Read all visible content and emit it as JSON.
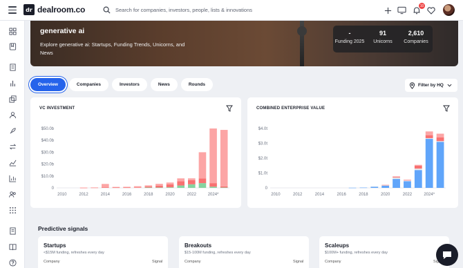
{
  "app": {
    "logo_text": "dealroom.co",
    "logo_mark": "dr"
  },
  "search": {
    "placeholder": "Search for companies, investors, people, lists & innovations"
  },
  "notifications": {
    "count": "10"
  },
  "hero": {
    "title": "generative ai",
    "description": "Explore generative ai: Startups, Funding Trends, Unicorns, and News",
    "stats": [
      {
        "value": "-",
        "label": "Funding 2025"
      },
      {
        "value": "91",
        "label": "Unicorns"
      },
      {
        "value": "2,610",
        "label": "Companies"
      }
    ]
  },
  "tabs": [
    "Overview",
    "Companies",
    "Investors",
    "News",
    "Rounds"
  ],
  "active_tab": "Overview",
  "filter_hq": "Filter by HQ",
  "vc_card": {
    "title": "VC INVESTMENT"
  },
  "ev_card": {
    "title": "COMBINED ENTERPRISE VALUE"
  },
  "chart_data": [
    {
      "type": "bar",
      "title": "VC INVESTMENT",
      "stacked": true,
      "x_ticks": [
        "2010",
        "2012",
        "2014",
        "2016",
        "2018",
        "2020",
        "2022",
        "2024*"
      ],
      "y_ticks": [
        "0",
        "$10.0b",
        "$20.0b",
        "$30.0b",
        "$40.0b",
        "$50.0b"
      ],
      "ylim": [
        0,
        50
      ],
      "unit": "b",
      "categories": [
        "2010",
        "2011",
        "2012",
        "2013",
        "2014",
        "2015",
        "2016",
        "2017",
        "2018",
        "2019",
        "2020",
        "2021",
        "2022",
        "2023",
        "2024",
        "2025"
      ],
      "series": [
        {
          "color": "#86d3a0",
          "values": [
            0,
            0,
            0,
            0,
            0,
            0,
            0,
            0,
            0.3,
            0.3,
            0.5,
            2.0,
            3.0,
            4.0,
            1.0,
            0.3
          ]
        },
        {
          "color": "#f87171",
          "values": [
            0,
            0,
            0.1,
            0.2,
            0.5,
            0.3,
            0.3,
            0.4,
            0.8,
            1.5,
            2.5,
            3.5,
            3.5,
            4.0,
            3.0,
            1.0
          ]
        },
        {
          "color": "#fca5a5",
          "values": [
            0,
            0,
            0.2,
            0.2,
            2.8,
            0.5,
            0.6,
            1.0,
            1.0,
            1.6,
            1.5,
            2.5,
            1.5,
            22,
            46,
            47.5
          ]
        }
      ],
      "grid": false,
      "legend": "none"
    },
    {
      "type": "bar",
      "title": "COMBINED ENTERPRISE VALUE",
      "stacked": true,
      "x_ticks": [
        "2010",
        "2012",
        "2014",
        "2016",
        "2018",
        "2020",
        "2022",
        "2024*"
      ],
      "y_ticks": [
        "0",
        "$1.0t",
        "$2.0t",
        "$3.0t",
        "$4.0t"
      ],
      "ylim": [
        0,
        4
      ],
      "unit": "t",
      "categories": [
        "2010",
        "2011",
        "2012",
        "2013",
        "2014",
        "2015",
        "2016",
        "2017",
        "2018",
        "2019",
        "2020",
        "2021",
        "2022",
        "2023",
        "2024",
        "2025"
      ],
      "series": [
        {
          "color": "#60a5fa",
          "values": [
            0,
            0,
            0,
            0,
            0,
            0,
            0,
            0.01,
            0.02,
            0.08,
            0.15,
            0.6,
            0.45,
            1.2,
            3.3,
            3.1
          ]
        },
        {
          "color": "#e5e7eb",
          "values": [
            0,
            0,
            0,
            0,
            0,
            0,
            0,
            0,
            0,
            0.02,
            0.03,
            0.1,
            0.05,
            0.1,
            0.05,
            0.05
          ]
        },
        {
          "color": "#f87171",
          "values": [
            0,
            0,
            0,
            0,
            0,
            0,
            0,
            0,
            0,
            0,
            0.02,
            0.05,
            0.03,
            0.2,
            0.2,
            0.25
          ]
        },
        {
          "color": "#fca5a5",
          "values": [
            0,
            0,
            0,
            0,
            0,
            0,
            0,
            0,
            0,
            0,
            0,
            0.02,
            0.02,
            0.05,
            0.25,
            0.25
          ]
        }
      ],
      "grid": false,
      "legend": "none"
    }
  ],
  "signals": {
    "title": "Predictive signals",
    "cards": [
      {
        "name": "Startups",
        "sub": "<$15M funding, refreshes every day",
        "col_company": "Company",
        "col_signal": "Signal"
      },
      {
        "name": "Breakouts",
        "sub": "$15-100M funding, refreshes every day",
        "col_company": "Company",
        "col_signal": "Signal"
      },
      {
        "name": "Scaleups",
        "sub": "$100M+ funding, refreshes every day",
        "col_company": "Company",
        "col_signal": "Signal"
      }
    ]
  }
}
